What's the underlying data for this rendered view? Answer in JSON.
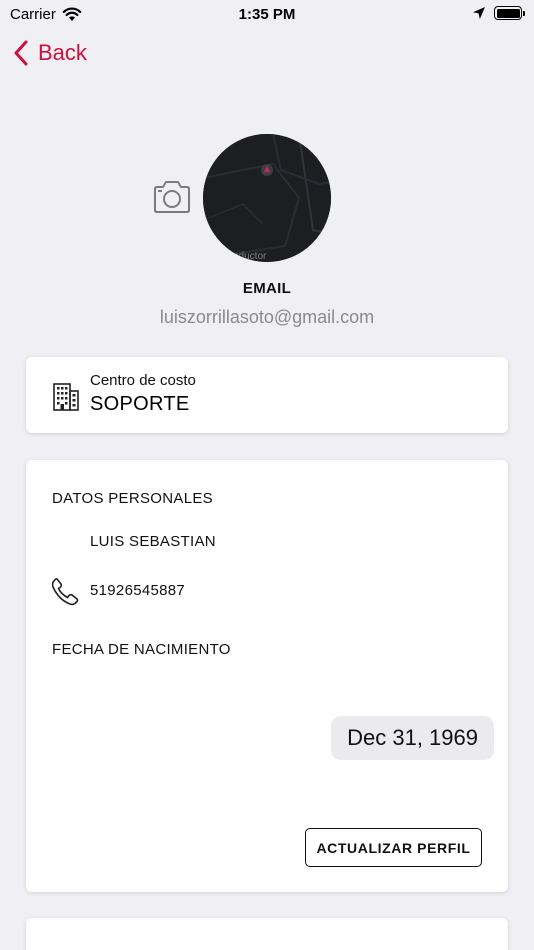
{
  "status_bar": {
    "carrier": "Carrier",
    "time": "1:35 PM"
  },
  "nav": {
    "back_label": "Back",
    "accent_color": "#d0103a"
  },
  "profile": {
    "avatar_caption": "nductor",
    "email_label": "EMAIL",
    "email_value": "luiszorrillasoto@gmail.com"
  },
  "cost_center": {
    "label": "Centro de costo",
    "value": "SOPORTE"
  },
  "personal": {
    "title": "DATOS PERSONALES",
    "name": "LUIS SEBASTIAN",
    "phone": "51926545887",
    "birth_label": "FECHA DE NACIMIENTO",
    "birth_date": "Dec 31, 1969",
    "update_button": "ACTUALIZAR PERFIL"
  },
  "icons": [
    "wifi-icon",
    "location-arrow-icon",
    "battery-icon",
    "chevron-left-icon",
    "camera-icon",
    "building-icon",
    "phone-icon"
  ]
}
